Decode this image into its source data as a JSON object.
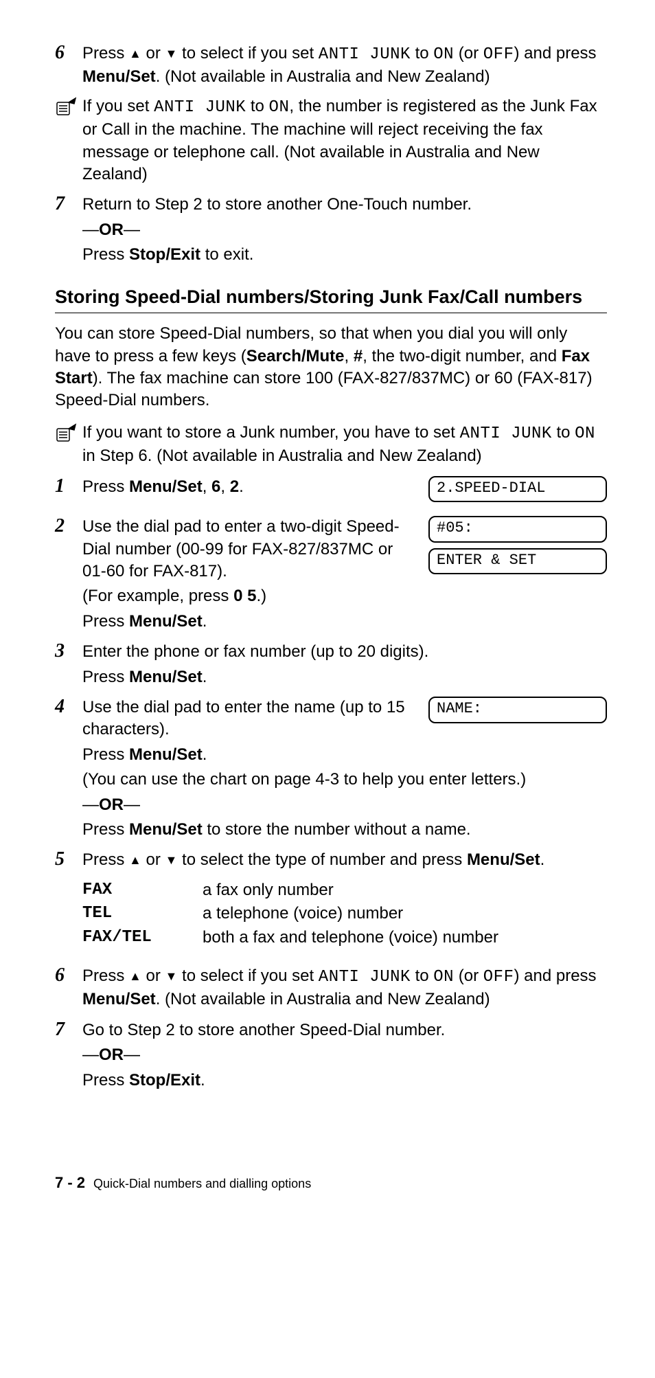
{
  "top_steps": {
    "s6": {
      "num": "6",
      "p1a": "Press ",
      "p1b": " or ",
      "p1c": " to select if you set ",
      "code1": "ANTI JUNK",
      "p1d": " to ",
      "code2": "ON",
      "p1e": " (or ",
      "code3": "OFF",
      "p1f": ") and press ",
      "bold1": "Menu/Set",
      "p1g": ". (Not available in Australia and New Zealand)"
    },
    "note1": {
      "p1a": "If you set ",
      "code1": "ANTI JUNK",
      "p1b": " to ",
      "code2": "ON",
      "p1c": ", the number is registered as the Junk Fax or Call in the machine. The machine will reject receiving the fax message or telephone call. (Not available in Australia and New Zealand)"
    },
    "s7": {
      "num": "7",
      "p1": "Return to Step 2 to store another One-Touch number.",
      "or": "—",
      "or_bold": "OR",
      "or2": "—",
      "p2a": "Press ",
      "bold1": "Stop/Exit",
      "p2b": " to exit."
    }
  },
  "section": {
    "title": "Storing Speed-Dial numbers/Storing Junk Fax/Call numbers",
    "intro_a": "You can store Speed-Dial numbers, so that when you dial you will only have to press a few keys (",
    "intro_b1": "Search/Mute",
    "intro_c": ", ",
    "intro_b2": "#",
    "intro_d": ", the two-digit number, and ",
    "intro_b3": "Fax Start",
    "intro_e": "). The fax machine can store 100 (FAX-827/837MC) or 60 (FAX-817) Speed-Dial numbers."
  },
  "note2": {
    "p1a": "If you want to store a Junk number, you have to set ",
    "code1": "ANTI JUNK",
    "p1b": " to ",
    "code2": "ON",
    "p1c": " in Step 6. (Not available in Australia and New Zealand)"
  },
  "steps": {
    "s1": {
      "num": "1",
      "p1a": "Press ",
      "b1": "Menu/Set",
      "p1b": ", ",
      "b2": "6",
      "p1c": ", ",
      "b3": "2",
      "p1d": ".",
      "display": "2.SPEED-DIAL"
    },
    "s2": {
      "num": "2",
      "p1": "Use the dial pad to enter a two-digit Speed-Dial number (00-99 for FAX-827/837MC or 01-60 for FAX-817).",
      "p2a": "(For example, press ",
      "b1": "0 5",
      "p2b": ".)",
      "p3a": "Press ",
      "b2": "Menu/Set",
      "p3b": ".",
      "display1": "#05:",
      "display2": "ENTER & SET"
    },
    "s3": {
      "num": "3",
      "p1": "Enter the phone or fax number (up to 20 digits).",
      "p2a": "Press ",
      "b1": "Menu/Set",
      "p2b": "."
    },
    "s4": {
      "num": "4",
      "p1": "Use the dial pad to enter the name (up to 15 characters).",
      "p2a": "Press ",
      "b1": "Menu/Set",
      "p2b": ".",
      "p3": "(You can use the chart on page 4-3 to help you enter letters.)",
      "or1": "—",
      "or_b": "OR",
      "or2": "—",
      "p4a": "Press ",
      "b2": "Menu/Set",
      "p4b": " to store the number without a name.",
      "display": "NAME:"
    },
    "s5": {
      "num": "5",
      "p1a": "Press ",
      "p1b": " or ",
      "p1c": " to select the type of number and press ",
      "b1": "Menu/Set",
      "p1d": ".",
      "types": [
        {
          "key": "FAX",
          "val": "a fax only number"
        },
        {
          "key": "TEL",
          "val": "a telephone (voice) number"
        },
        {
          "key": "FAX/TEL",
          "val": "both a fax and telephone (voice) number"
        }
      ]
    },
    "s6": {
      "num": "6",
      "p1a": "Press ",
      "p1b": " or ",
      "p1c": " to select if you set ",
      "code1": "ANTI JUNK",
      "p1d": " to ",
      "code2": "ON",
      "p1e": " (or ",
      "code3": "OFF",
      "p1f": ") and press ",
      "b1": "Menu/Set",
      "p1g": ". (Not available in Australia and New Zealand)"
    },
    "s7": {
      "num": "7",
      "p1": "Go to Step 2 to store another Speed-Dial number.",
      "or1": "—",
      "or_b": "OR",
      "or2": "—",
      "p2a": "Press ",
      "b1": "Stop/Exit",
      "p2b": "."
    }
  },
  "footer": {
    "page": "7 - 2",
    "title": "Quick-Dial numbers and dialling options"
  },
  "glyphs": {
    "up": "▲",
    "down": "▼"
  }
}
